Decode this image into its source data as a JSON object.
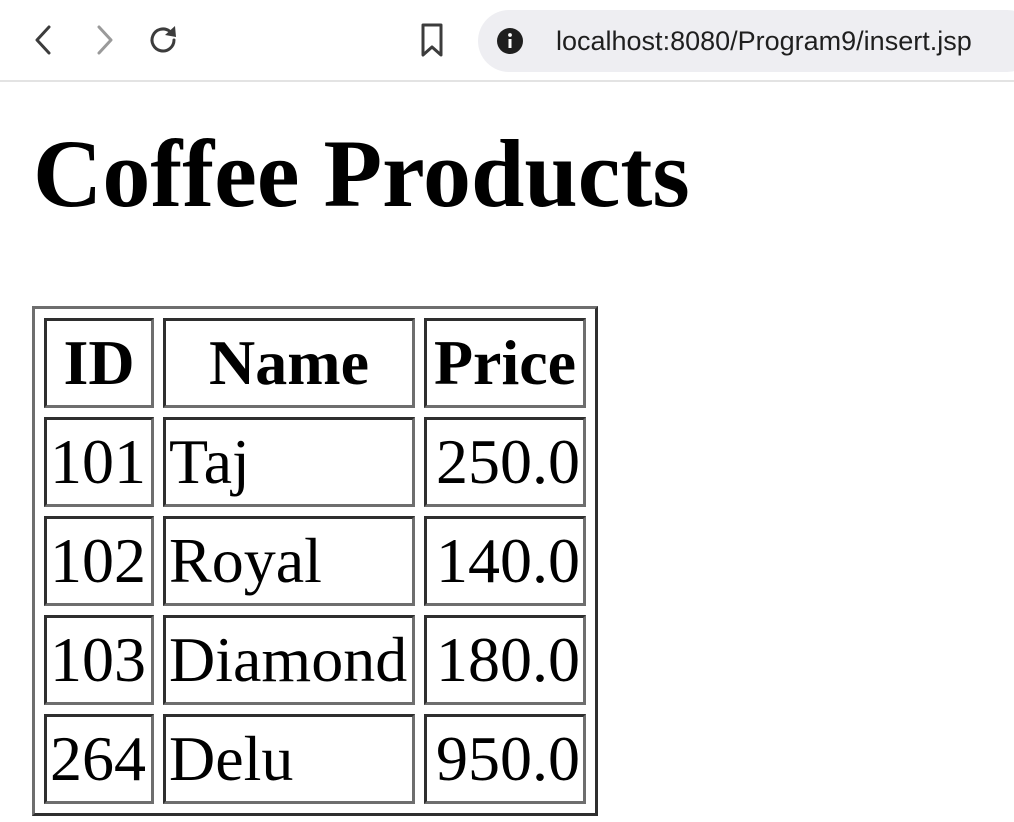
{
  "browser": {
    "url": "localhost:8080/Program9/insert.jsp",
    "icons": {
      "back": "chevron-left-icon",
      "forward": "chevron-right-icon",
      "reload": "reload-icon",
      "bookmark": "bookmark-icon",
      "site_info": "info-icon"
    },
    "colors": {
      "urlbar_bg": "#eeeef2",
      "forward_disabled": "#9a9a9a"
    }
  },
  "page": {
    "title": "Coffee Products",
    "table": {
      "headers": [
        "ID",
        "Name",
        "Price"
      ],
      "rows": [
        [
          "101",
          "Taj",
          "250.0"
        ],
        [
          "102",
          "Royal",
          "140.0"
        ],
        [
          "103",
          "Diamond",
          "180.0"
        ],
        [
          "264",
          "Delu",
          "950.0"
        ]
      ]
    }
  }
}
